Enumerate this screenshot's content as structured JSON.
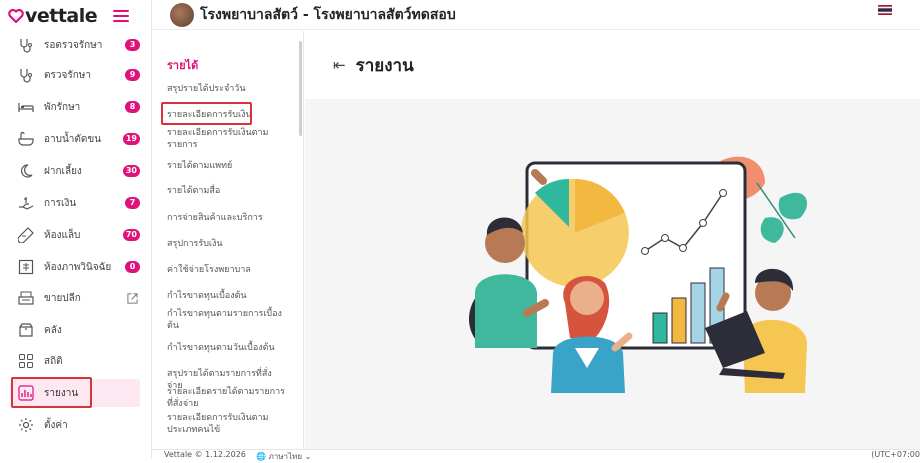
{
  "brand": {
    "name": "vettale",
    "accent": "#e0127a"
  },
  "topbar": {
    "clinic_title": "โรงพยาบาลสัตว์ - โรงพยาบาลสัตว์ทดสอบ",
    "flag": "thai-flag-icon"
  },
  "sidebar": {
    "items": [
      {
        "label": "รอตรวจรักษา",
        "badge": "3",
        "icon": "stethoscope-icon"
      },
      {
        "label": "ตรวจรักษา",
        "badge": "9",
        "icon": "stethoscope-icon"
      },
      {
        "label": "พักรักษา",
        "badge": "8",
        "icon": "bed-icon"
      },
      {
        "label": "อาบน้ำตัดขน",
        "badge": "19",
        "icon": "bathtub-icon"
      },
      {
        "label": "ฝากเลี้ยง",
        "badge": "30",
        "icon": "moon-icon"
      },
      {
        "label": "การเงิน",
        "badge": "7",
        "icon": "hand-money-icon"
      },
      {
        "label": "ห้องแล็บ",
        "badge": "70",
        "icon": "test-tube-icon"
      },
      {
        "label": "ห้องภาพวินิจฉัย",
        "badge": "0",
        "icon": "xray-icon"
      },
      {
        "label": "ขายปลีก",
        "badge": "",
        "icon": "register-icon"
      },
      {
        "label": "คลัง",
        "badge": "",
        "icon": "box-icon"
      },
      {
        "label": "สถิติ",
        "badge": "",
        "icon": "grid-icon"
      },
      {
        "label": "รายงาน",
        "badge": "",
        "icon": "bar-chart-icon"
      },
      {
        "label": "ตั้งค่า",
        "badge": "",
        "icon": "gear-icon"
      }
    ]
  },
  "submenu": {
    "heading": "รายได้",
    "items": [
      "สรุปรายได้ประจำวัน",
      "รายละเอียดการรับเงิน",
      "รายละเอียดการรับเงินตามรายการ",
      "รายได้ตามแพทย์",
      "รายได้ตามสื่อ",
      "การจ่ายสินค้าและบริการ",
      "สรุปการรับเงิน",
      "ค่าใช้จ่ายโรงพยาบาล",
      "กำไรขาดทุนเบื้องต้น",
      "กำไรขาดทุนตามรายการเบื้องต้น",
      "กำไรขาดทุนตามวันเบื้องต้น",
      "สรุปรายได้ตามรายการที่สั่งจ่าย",
      "รายละเอียดรายได้ตามรายการที่สั่งจ่าย",
      "รายละเอียดการรับเงินตามประเภทคนไข้"
    ]
  },
  "main": {
    "title": "รายงาน"
  },
  "footer": {
    "version": "Vettale © 1.12.2026",
    "language": "ภาษาไทย",
    "timezone": "(UTC+07:00"
  }
}
